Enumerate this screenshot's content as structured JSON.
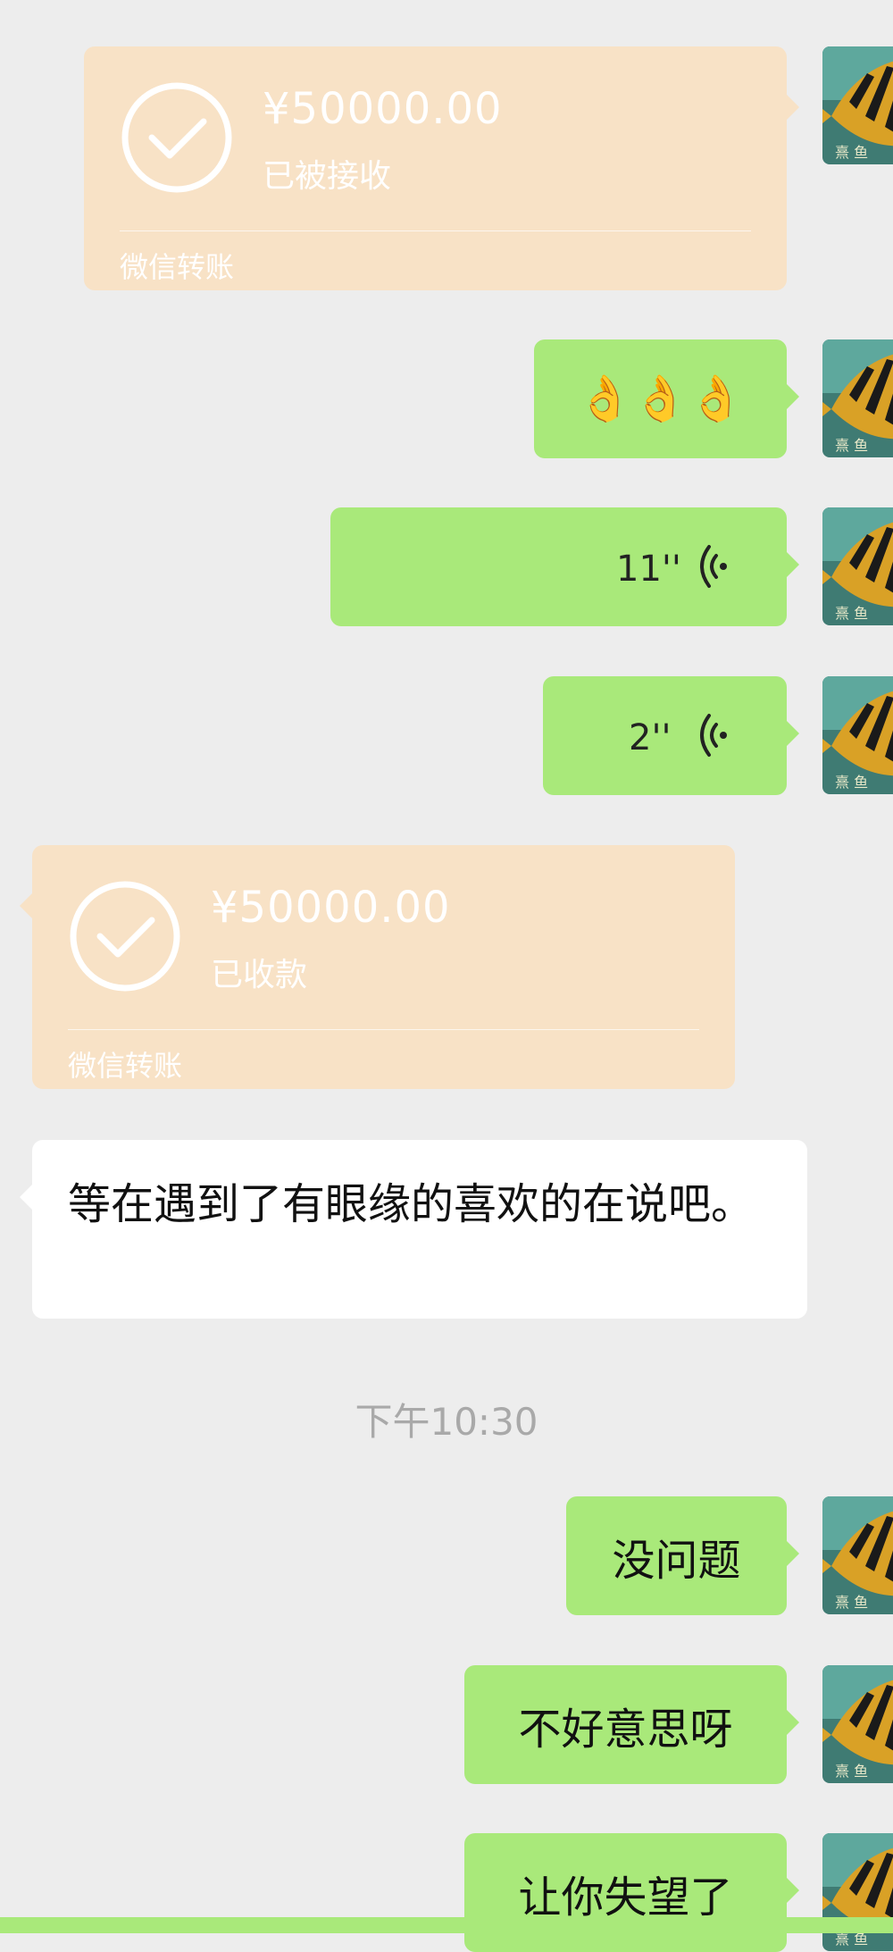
{
  "messages": {
    "transfer_sent": {
      "amount": "¥50000.00",
      "status": "已被接收",
      "footer": "微信转账"
    },
    "emoji_msg": {
      "text": "👌👌👌"
    },
    "voice_1": {
      "duration": "11''"
    },
    "voice_2": {
      "duration": "2''"
    },
    "transfer_received": {
      "amount": "¥50000.00",
      "status": "已收款",
      "footer": "微信转账"
    },
    "text_received": {
      "text": "等在遇到了有眼缘的喜欢的在说吧。"
    },
    "timestamp": {
      "text": "下午10:30"
    },
    "text_sent_1": {
      "text": "没问题"
    },
    "text_sent_2": {
      "text": "不好意思呀"
    },
    "text_sent_3": {
      "text": "让你失望了"
    }
  },
  "colors": {
    "background": "#ededed",
    "sent_bubble": "#a9e97a",
    "received_bubble": "#ffffff",
    "transfer_card": "#f8e2c6",
    "timestamp_text": "#a9a9a9"
  },
  "icons": {
    "avatar": "tiger-fish-avatar",
    "transfer_check": "check-circle-icon",
    "voice": "voice-wave-icon"
  }
}
